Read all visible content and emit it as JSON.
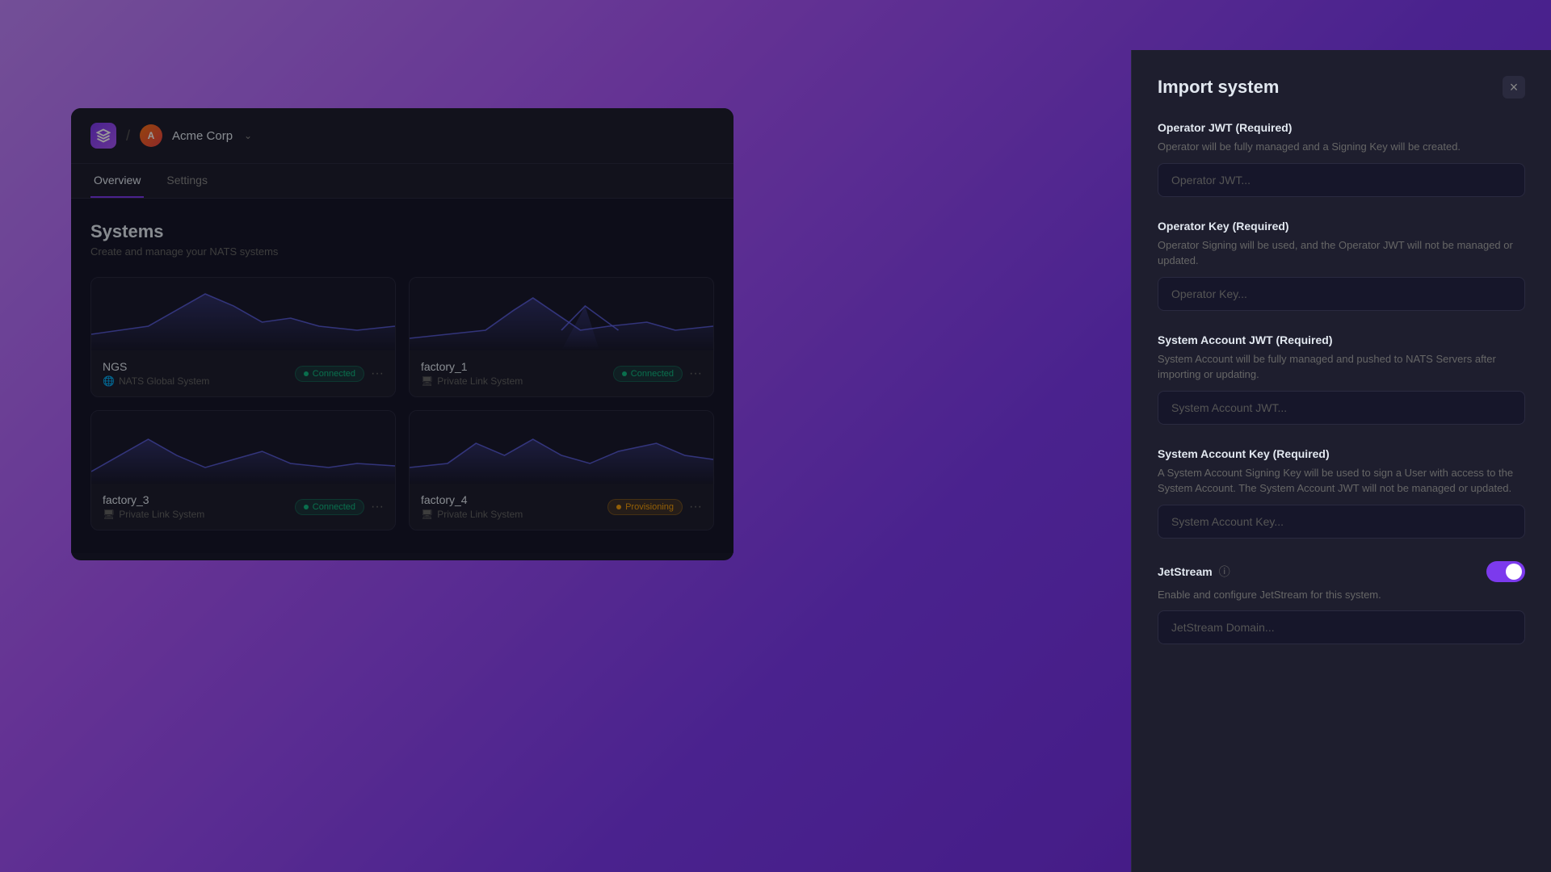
{
  "app": {
    "logo_icon": "S",
    "breadcrumb_sep": "/",
    "org_initial": "A",
    "org_name": "Acme Corp",
    "chevron": "⌄"
  },
  "nav": {
    "tabs": [
      {
        "label": "Overview",
        "active": true
      },
      {
        "label": "Settings",
        "active": false
      }
    ]
  },
  "systems": {
    "title": "Systems",
    "subtitle": "Create and manage your NATS systems",
    "cards": [
      {
        "id": "ngs",
        "name": "NGS",
        "type": "NATS Global System",
        "type_icon": "🌐",
        "status": "Connected",
        "status_type": "connected"
      },
      {
        "id": "factory_1",
        "name": "factory_1",
        "type": "Private Link System",
        "type_icon": "🖥",
        "status": "Connected",
        "status_type": "connected"
      },
      {
        "id": "factory_3",
        "name": "factory_3",
        "type": "Private Link System",
        "type_icon": "🖥",
        "status": "Connected",
        "status_type": "connected"
      },
      {
        "id": "factory_4",
        "name": "factory_4",
        "type": "Private Link System",
        "type_icon": "🖥",
        "status": "Provisioning",
        "status_type": "provisioning"
      }
    ]
  },
  "modal": {
    "title": "Import system",
    "close_label": "×",
    "fields": [
      {
        "id": "operator_jwt",
        "label": "Operator JWT (Required)",
        "description": "Operator will be fully managed and a Signing Key will be created.",
        "placeholder": "Operator JWT..."
      },
      {
        "id": "operator_key",
        "label": "Operator Key (Required)",
        "description": "Operator Signing will be used, and the Operator JWT will not be managed or updated.",
        "placeholder": "Operator Key..."
      },
      {
        "id": "system_account_jwt",
        "label": "System Account JWT (Required)",
        "description": "System Account will be fully managed and pushed to NATS Servers after importing or updating.",
        "placeholder": "System Account JWT..."
      },
      {
        "id": "system_account_key",
        "label": "System Account Key (Required)",
        "description": "A System Account Signing Key will be used to sign a User with access to the System Account. The System Account JWT will not be managed or updated.",
        "placeholder": "System Account Key..."
      }
    ],
    "jetstream": {
      "title": "JetStream",
      "info_icon": "ⓘ",
      "description": "Enable and configure JetStream for this system.",
      "enabled": true,
      "domain_placeholder": "JetStream Domain..."
    }
  }
}
